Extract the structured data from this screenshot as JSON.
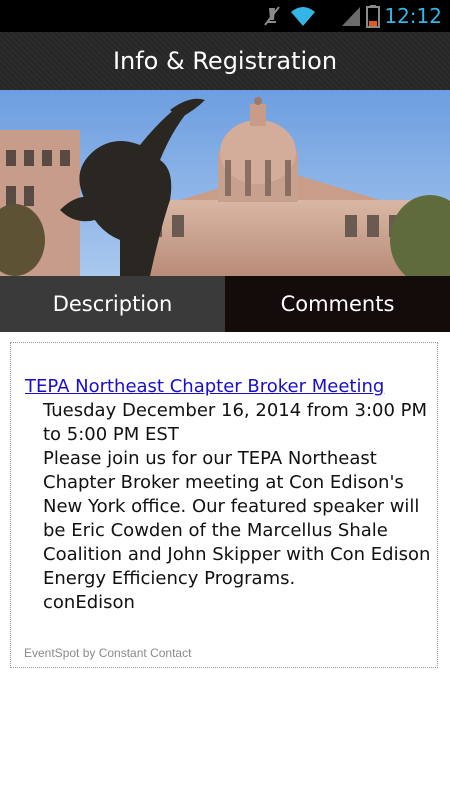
{
  "status_bar": {
    "time": "12:12",
    "icons": [
      "mute-icon",
      "wifi-icon",
      "signal-icon",
      "battery-icon"
    ]
  },
  "action_bar": {
    "title": "Info & Registration"
  },
  "header_image": {
    "description_icon": "capitol-building-image"
  },
  "tabs": [
    {
      "label": "Description",
      "selected": true
    },
    {
      "label": "Comments",
      "selected": false
    }
  ],
  "event": {
    "title": "TEPA Northeast Chapter Broker Meeting",
    "datetime": "Tuesday December 16, 2014 from 3:00 PM to 5:00 PM EST",
    "description": "Please join us for our TEPA Northeast Chapter Broker meeting at Con Edison's New York office. Our featured speaker will be Eric Cowden of the Marcellus Shale Coalition and John Skipper with Con Edison Energy Efficiency Programs.",
    "organizer": "conEdison"
  },
  "footer": {
    "text": "EventSpot by Constant Contact"
  },
  "colors": {
    "status_time": "#33b5e5",
    "link": "#1a0dcc",
    "tab_selected": "#3a3a3a",
    "tab_unselected": "#140c0a"
  }
}
